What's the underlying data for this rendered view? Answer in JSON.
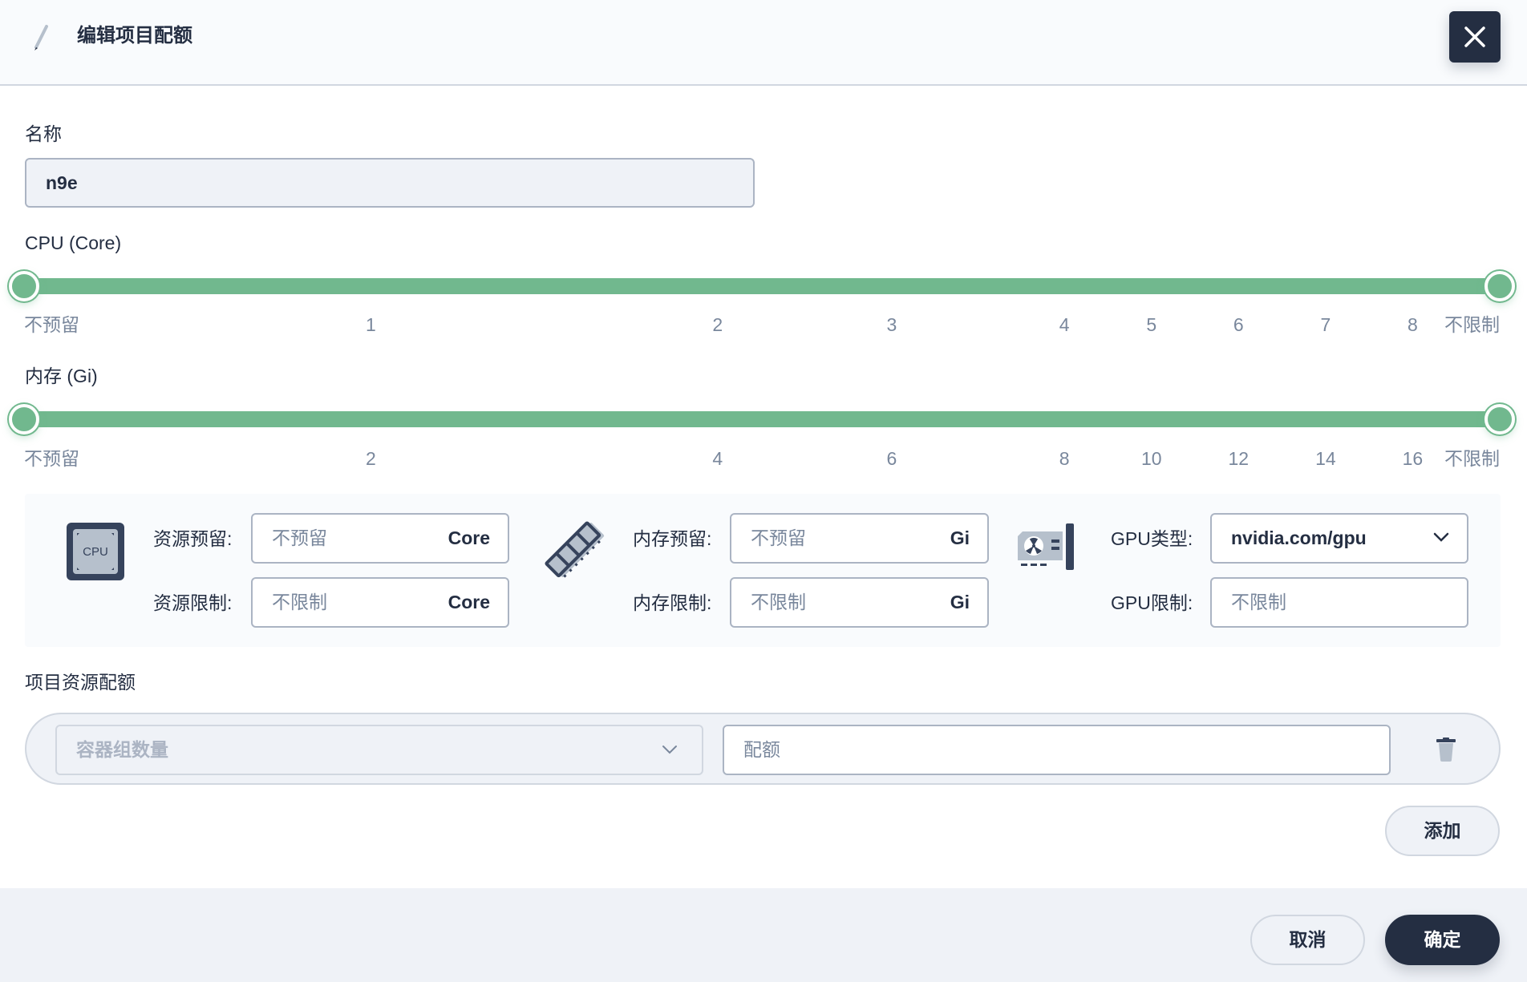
{
  "header": {
    "title": "编辑项目配额",
    "close_label": "close"
  },
  "form": {
    "name": {
      "label": "名称",
      "value": "n9e"
    },
    "cpu": {
      "label": "CPU (Core)",
      "range": {
        "min_label": "不预留",
        "max_label": "不限制",
        "low": "不预留",
        "high": "不限制"
      },
      "marks": [
        "不预留",
        "1",
        "2",
        "3",
        "4",
        "5",
        "6",
        "7",
        "8",
        "不限制"
      ]
    },
    "memory": {
      "label": "内存 (Gi)",
      "range": {
        "low": "不预留",
        "high": "不限制"
      },
      "marks": [
        "不预留",
        "2",
        "4",
        "6",
        "8",
        "10",
        "12",
        "14",
        "16",
        "不限制"
      ]
    }
  },
  "resources": {
    "cpu": {
      "icon": "cpu-icon",
      "icon_text": "CPU",
      "request_label": "资源预留:",
      "request_placeholder": "不预留",
      "request_unit": "Core",
      "limit_label": "资源限制:",
      "limit_placeholder": "不限制",
      "limit_unit": "Core"
    },
    "memory": {
      "icon": "memory-icon",
      "request_label": "内存预留:",
      "request_placeholder": "不预留",
      "request_unit": "Gi",
      "limit_label": "内存限制:",
      "limit_placeholder": "不限制",
      "limit_unit": "Gi"
    },
    "gpu": {
      "icon": "gpu-icon",
      "type_label": "GPU类型:",
      "type_value": "nvidia.com/gpu",
      "limit_label": "GPU限制:",
      "limit_placeholder": "不限制"
    }
  },
  "quota": {
    "section_label": "项目资源配额",
    "rows": [
      {
        "resource_placeholder": "容器组数量",
        "quota_placeholder": "配额"
      }
    ],
    "add_label": "添加"
  },
  "footer": {
    "cancel_label": "取消",
    "confirm_label": "确定"
  },
  "colors": {
    "primary_dark": "#242e42",
    "slider_green": "#71b88e",
    "muted_text": "#79879c",
    "panel_bg": "#f9fbfd",
    "footer_bg": "#eff2f7"
  }
}
